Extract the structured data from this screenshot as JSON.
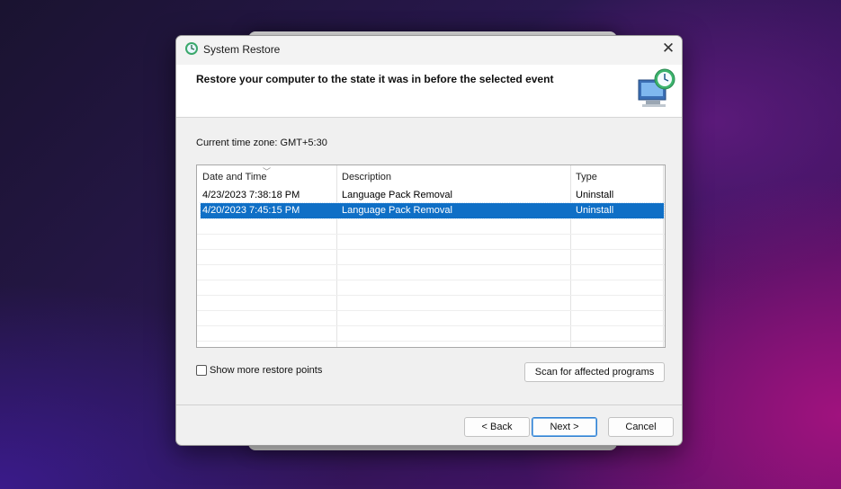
{
  "window": {
    "title": "System Restore",
    "close_glyph": "✕"
  },
  "header": {
    "text": "Restore your computer to the state it was in before the selected event",
    "icon": "system-restore-icon"
  },
  "timezone": "Current time zone: GMT+5:30",
  "table": {
    "columns": [
      "Date and Time",
      "Description",
      "Type"
    ],
    "rows": [
      {
        "date": "4/23/2023 7:38:18 PM",
        "description": "Language Pack Removal",
        "type": "Uninstall",
        "selected": false
      },
      {
        "date": "4/20/2023 7:45:15 PM",
        "description": "Language Pack Removal",
        "type": "Uninstall",
        "selected": true
      }
    ]
  },
  "options": {
    "show_more_label": "Show more restore points",
    "show_more_checked": false
  },
  "buttons": {
    "scan": "Scan for affected programs",
    "back": "< Back",
    "next": "Next >",
    "cancel": "Cancel"
  },
  "colors": {
    "selection": "#0f6fc6",
    "default_button_border": "#2f7fd1"
  }
}
